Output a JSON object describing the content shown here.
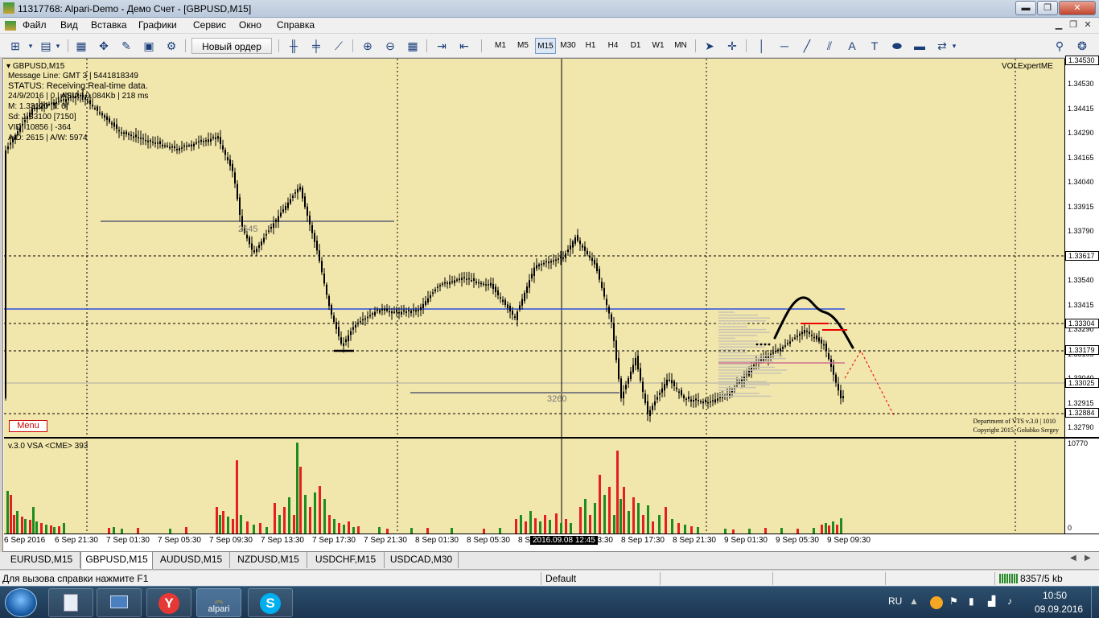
{
  "window": {
    "title": "11317768: Alpari-Demo - Демо Счет - [GBPUSD,M15]",
    "minimize": "▬",
    "restore": "❐",
    "close": "✕"
  },
  "menu": [
    "Файл",
    "Вид",
    "Вставка",
    "Графики",
    "Сервис",
    "Окно",
    "Справка"
  ],
  "toolbar": {
    "new_order": "Новый ордер",
    "timeframes": [
      "M1",
      "M5",
      "M15",
      "M30",
      "H1",
      "H4",
      "D1",
      "W1",
      "MN"
    ],
    "active_timeframe": "M15"
  },
  "chart": {
    "symbol_label": "GBPUSD,M15",
    "expert_label": "VOLExpertME",
    "info_lines": [
      "Message Line: GMT 3 | 5441818349",
      "STATUS:  Receiving  Real-time data.",
      "24/9/2016 | 0 | ASIA | 0.084Kb | 218 ms",
      "M: 1.33120 [T: 0]",
      "Sd: 1.33100 [7150]",
      "VID: 10856 | -364",
      "A/D: 2615 | A/W: 5974"
    ],
    "menu_button": "Menu",
    "copyright_1": "Department of VTS  v.3.0 | 1010",
    "copyright_2": "Copyright 2015, Golubko Sergey",
    "level_label_1": "2545",
    "level_label_2": "3260",
    "indicator_label": "v.3.0 VSA <CME> 393",
    "volume_max": "10770",
    "volume_zero": "0",
    "price_labels": [
      "1.34530",
      "1.34415",
      "1.34290",
      "1.34165",
      "1.34040",
      "1.33915",
      "1.33790",
      "1.33665",
      "1.33540",
      "1.33415",
      "1.33290",
      "1.33165",
      "1.33040",
      "1.32915",
      "1.32790"
    ],
    "price_boxes": [
      "1.34530",
      "1.33617",
      "1.33304",
      "1.33179",
      "1.33025",
      "1.32884"
    ],
    "time_labels": [
      "6 Sep 2016",
      "6 Sep 21:30",
      "7 Sep 01:30",
      "7 Sep 05:30",
      "7 Sep 09:30",
      "7 Sep 13:30",
      "7 Sep 17:30",
      "7 Sep 21:30",
      "8 Sep 01:30",
      "8 Sep 05:30",
      "8 Sep 09:30",
      "8 Sep 13:30",
      "8 Sep 17:30",
      "8 Sep 21:30",
      "9 Sep 01:30",
      "9 Sep 05:30",
      "9 Sep 09:30"
    ],
    "cursor_time": "2016.09.08 12:45",
    "colors": {
      "background": "#f1e6ab",
      "bull_volume": "#1e8c1e",
      "bear_volume": "#e31f1f",
      "support_line": "#2b4fe0",
      "level_line": "#7f7f7f"
    }
  },
  "tabs": [
    "EURUSD,M15",
    "GBPUSD,M15",
    "AUDUSD,M15",
    "NZDUSD,M15",
    "USDCHF,M15",
    "USDCAD,M30"
  ],
  "active_tab": "GBPUSD,M15",
  "status": {
    "help": "Для вызова справки нажмите F1",
    "profile": "Default",
    "traffic": "8357/5 kb"
  },
  "taskbar": {
    "apps": [
      "Calculator",
      "Remote Desktop",
      "Yandex",
      "alpari",
      "Skype"
    ],
    "alpari_label": "alpari",
    "lang": "RU",
    "time": "10:50",
    "date": "09.09.2016"
  }
}
